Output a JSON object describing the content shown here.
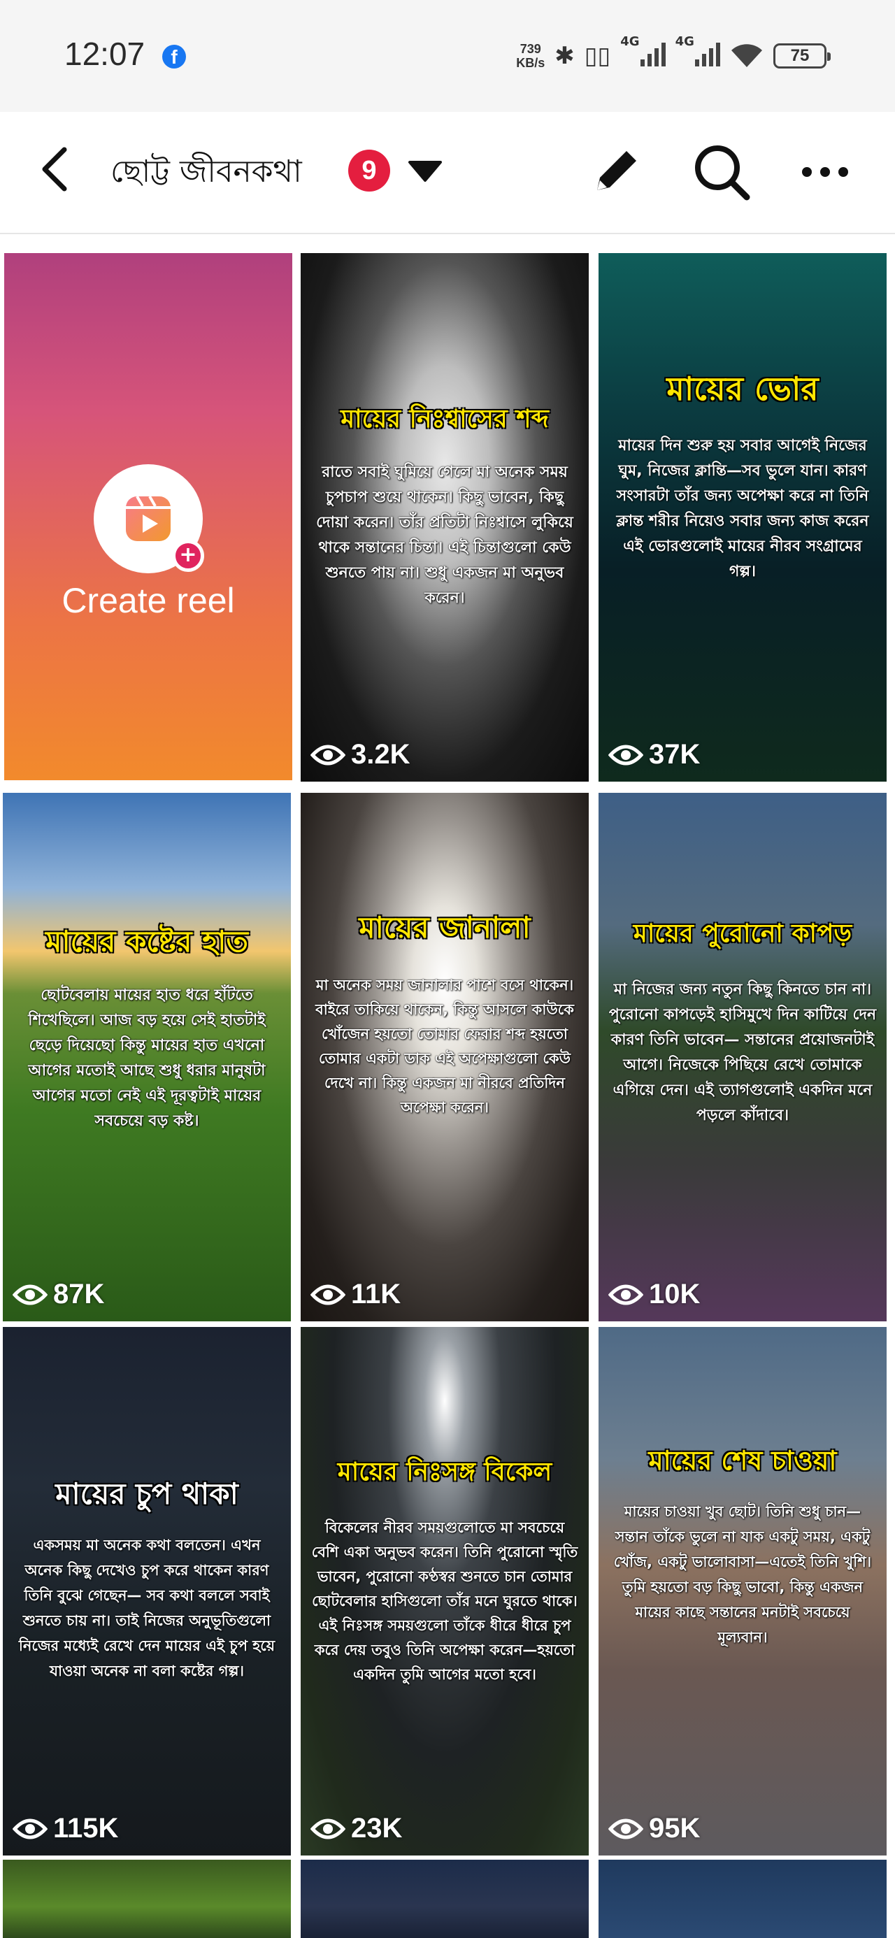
{
  "status_bar": {
    "time": "12:07",
    "facebook_notification": "f",
    "net_speed_value": "739",
    "net_speed_unit": "KB/s",
    "network_1": "4G",
    "network_2": "4G",
    "battery": "75"
  },
  "header": {
    "title": "ছোট্ট জীবনকথা",
    "badge_count": "9"
  },
  "create_reel": {
    "label": "Create reel"
  },
  "reels": [
    {
      "title": "মায়ের নিঃশ্বাসের শব্দ",
      "body": "রাতে সবাই ঘুমিয়ে গেলে মা অনেক সময় চুপচাপ শুয়ে থাকেন। কিছু ভাবেন, কিছু দোয়া করেন। তাঁর প্রতিটা নিঃশ্বাসে লুকিয়ে থাকে সন্তানের চিন্তা। এই চিন্তাগুলো কেউ শুনতে পায় না। শুধু একজন মা অনুভব করেন।",
      "views": "3.2K"
    },
    {
      "title": "মায়ের ভোর",
      "body": "মায়ের দিন শুরু হয় সবার আগেই নিজের ঘুম, নিজের ক্লান্তি—সব ভুলে যান। কারণ সংসারটা তাঁর জন্য অপেক্ষা করে না তিনি ক্লান্ত শরীর নিয়েও সবার জন্য কাজ করেন এই ভোরগুলোই মায়ের নীরব সংগ্রামের গল্প।",
      "views": "37K"
    },
    {
      "title": "মায়ের কষ্টের হাত",
      "body": "ছোটবেলায় মায়ের হাত ধরে হাঁটতে শিখেছিলে। আজ বড় হয়ে সেই হাতটাই ছেড়ে দিয়েছো কিন্তু মায়ের হাত এখনো আগের মতোই আছে শুধু ধরার মানুষটা আগের মতো নেই এই দূরত্বটাই মায়ের সবচেয়ে বড় কষ্ট।",
      "views": "87K"
    },
    {
      "title": "মায়ের জানালা",
      "body": "মা অনেক সময় জানালার পাশে বসে থাকেন। বাইরে তাকিয়ে থাকেন, কিন্তু আসলে কাউকে খোঁজেন হয়তো তোমার ফেরার শব্দ হয়তো তোমার একটা ডাক এই অপেক্ষাগুলো কেউ দেখে না। কিন্তু একজন মা নীরবে প্রতিদিন অপেক্ষা করেন।",
      "views": "11K"
    },
    {
      "title": "মায়ের পুরোনো কাপড়",
      "body": "মা নিজের জন্য নতুন কিছু কিনতে চান না। পুরোনো কাপড়েই হাসিমুখে দিন কাটিয়ে দেন কারণ তিনি ভাবেন— সন্তানের প্রয়োজনটাই আগে। নিজেকে পিছিয়ে রেখে তোমাকে এগিয়ে দেন। এই ত্যাগগুলোই একদিন মনে পড়লে কাঁদাবে।",
      "views": "10K"
    },
    {
      "title": "মায়ের চুপ থাকা",
      "body": "একসময় মা অনেক কথা বলতেন। এখন অনেক কিছু দেখেও চুপ করে থাকেন কারণ তিনি বুঝে গেছেন— সব কথা বললে সবাই শুনতে চায় না। তাই নিজের অনুভূতিগুলো নিজের মধ্যেই রেখে দেন মায়ের এই চুপ হয়ে যাওয়া অনেক না বলা কষ্টের গল্প।",
      "views": "115K"
    },
    {
      "title": "মায়ের নিঃসঙ্গ বিকেল",
      "body": "বিকেলের নীরব সময়গুলোতে মা সবচেয়ে বেশি একা অনুভব করেন। তিনি পুরোনো স্মৃতি ভাবেন, পুরোনো কণ্ঠস্বর শুনতে চান তোমার ছোটবেলার হাসিগুলো তাঁর মনে ঘুরতে থাকে। এই নিঃসঙ্গ সময়গুলো তাঁকে ধীরে ধীরে চুপ করে দেয় তবুও তিনি অপেক্ষা করেন—হয়তো একদিন তুমি আগের মতো হবে।",
      "views": "23K"
    },
    {
      "title": "মায়ের শেষ চাওয়া",
      "body": "মায়ের চাওয়া খুব ছোট। তিনি শুধু চান—সন্তান তাঁকে ভুলে না যাক একটু সময়, একটু খোঁজ, একটু ভালোবাসা—এতেই তিনি খুশি। তুমি হয়তো বড় কিছু ভাবো, কিন্তু একজন মায়ের কাছে সন্তানের মনটাই সবচেয়ে মূল্যবান।",
      "views": "95K"
    }
  ]
}
